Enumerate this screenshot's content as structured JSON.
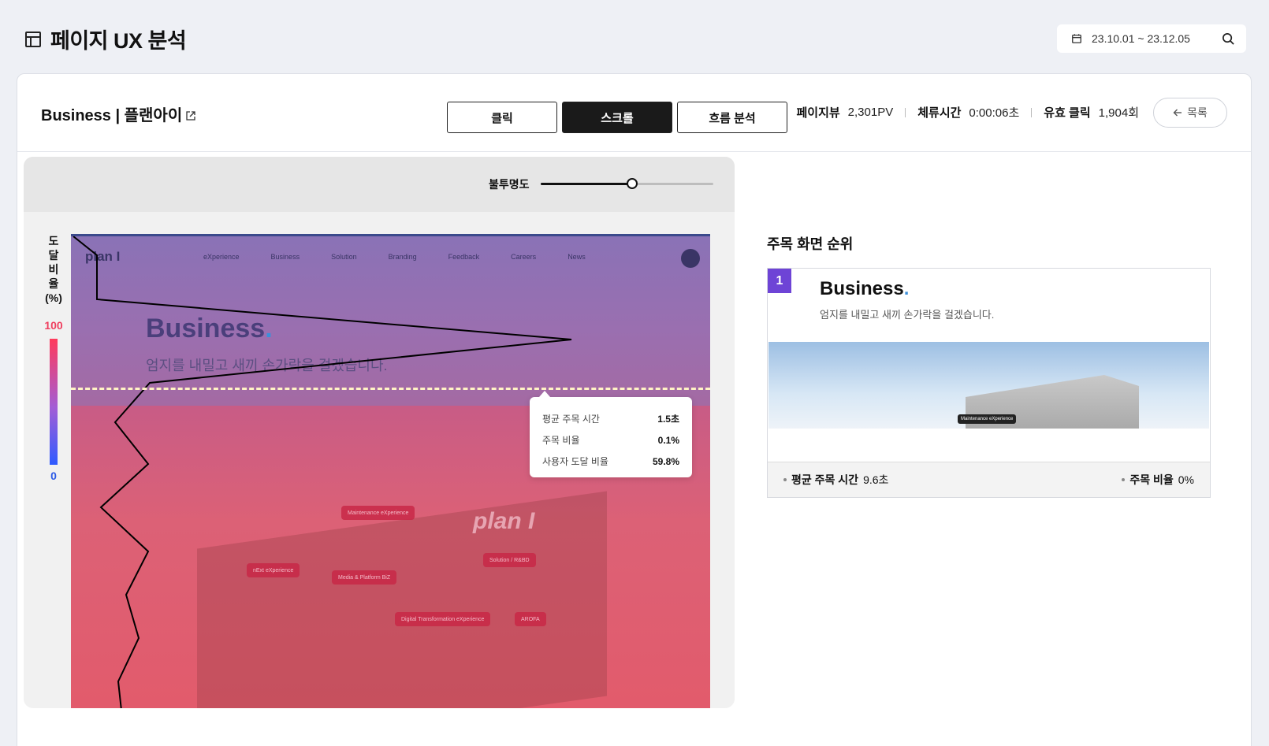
{
  "header": {
    "title": "페이지 UX 분석",
    "date_range": "23.10.01 ~ 23.12.05"
  },
  "page": {
    "name": "Business | 플랜아이",
    "metrics": [
      {
        "label": "페이지뷰",
        "value": "2,301PV"
      },
      {
        "label": "체류시간",
        "value": "0:00:06초"
      },
      {
        "label": "유효 클릭",
        "value": "1,904회"
      }
    ],
    "back_label": "목록"
  },
  "tabs": [
    {
      "label": "클릭",
      "active": false
    },
    {
      "label": "스크롤",
      "active": true
    },
    {
      "label": "흐름 분석",
      "active": false
    }
  ],
  "viewer": {
    "opacity_label": "불투명도",
    "opacity_value": 0.53,
    "axis_title": [
      "도",
      "달",
      "비",
      "율",
      "(%)"
    ],
    "legend_max": "100",
    "legend_min": "0",
    "preview": {
      "logo": "plan I",
      "nav": [
        "eXperience",
        "Business",
        "Solution",
        "Branding",
        "Feedback",
        "Careers",
        "News"
      ],
      "heading": "Business",
      "heading_dot": ".",
      "subheading": "엄지를 내밀고 새끼 손가락을 걸겠습니다.",
      "sign": "plan I",
      "chips": [
        "Maintenance eXperience",
        "Solution / R&BD",
        "nExt eXperience",
        "Media & Platform BiZ",
        "Digital Transformation eXperience",
        "AROFA"
      ]
    },
    "tooltip": [
      {
        "label": "평균 주목 시간",
        "value": "1.5초"
      },
      {
        "label": "주목 비율",
        "value": "0.1%"
      },
      {
        "label": "사용자 도달 비율",
        "value": "59.8%"
      }
    ]
  },
  "ranking": {
    "title": "주목 화면 순위",
    "items": [
      {
        "rank": "1",
        "heading": "Business",
        "heading_dot": ".",
        "subheading": "엄지를 내밀고 새끼 손가락을 걸겠습니다.",
        "image_tag": "Maintenance eXperience",
        "avg_time_label": "평균 주목 시간",
        "avg_time": "9.6초",
        "ratio_label": "주목 비율",
        "ratio": "0%"
      }
    ]
  }
}
